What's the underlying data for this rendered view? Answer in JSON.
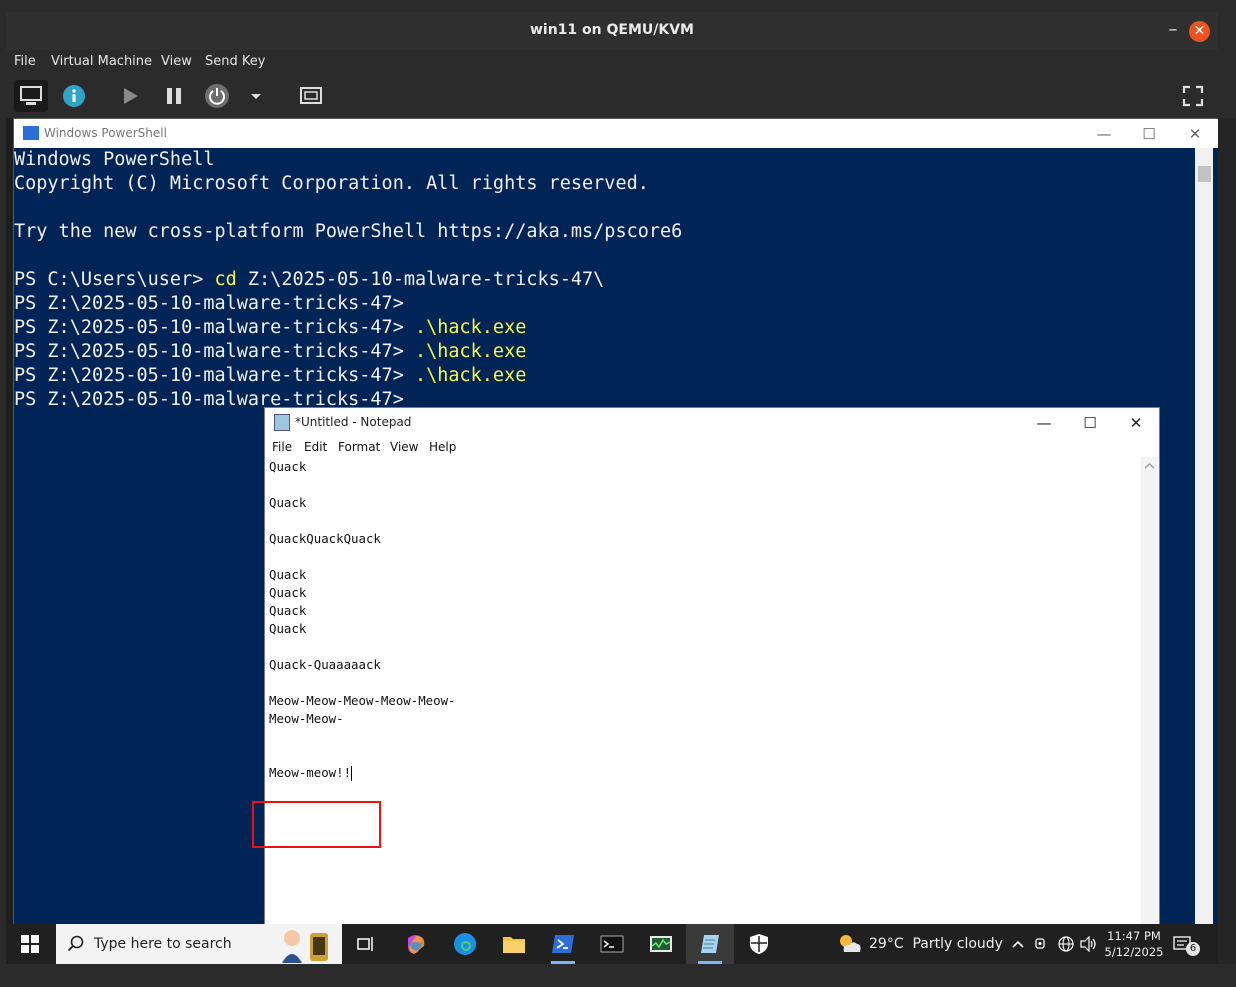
{
  "vm": {
    "title": "win11 on QEMU/KVM",
    "minimize": "–",
    "close": "✕",
    "menu": [
      "File",
      "Virtual Machine",
      "View",
      "Send Key"
    ]
  },
  "powershell": {
    "title": "Windows PowerShell",
    "controls": {
      "minimize": "—",
      "maximize": "☐",
      "close": "✕"
    },
    "lines": [
      {
        "text": "Windows PowerShell",
        "cmd": ""
      },
      {
        "text": "Copyright (C) Microsoft Corporation. All rights reserved.",
        "cmd": ""
      },
      {
        "text": "",
        "cmd": ""
      },
      {
        "text": "Try the new cross-platform PowerShell https://aka.ms/pscore6",
        "cmd": ""
      },
      {
        "text": "",
        "cmd": ""
      },
      {
        "text": "PS C:\\Users\\user> ",
        "cmd": "cd",
        "rest": " Z:\\2025-05-10-malware-tricks-47\\"
      },
      {
        "text": "PS Z:\\2025-05-10-malware-tricks-47>",
        "cmd": ""
      },
      {
        "text": "PS Z:\\2025-05-10-malware-tricks-47> ",
        "cmd": ".\\hack.exe"
      },
      {
        "text": "PS Z:\\2025-05-10-malware-tricks-47> ",
        "cmd": ".\\hack.exe"
      },
      {
        "text": "PS Z:\\2025-05-10-malware-tricks-47> ",
        "cmd": ".\\hack.exe"
      },
      {
        "text": "PS Z:\\2025-05-10-malware-tricks-47> ",
        "cmd": "_"
      }
    ]
  },
  "notepad": {
    "title": "*Untitled - Notepad",
    "controls": {
      "minimize": "—",
      "maximize": "☐",
      "close": "✕"
    },
    "menu": [
      "File",
      "Edit",
      "Format",
      "View",
      "Help"
    ],
    "lines": [
      "Quack",
      "",
      "Quack",
      "",
      "QuackQuackQuack",
      "",
      "Quack",
      "Quack",
      "Quack",
      "Quack",
      "",
      "Quack-Quaaaaack",
      "",
      "Meow-Meow-Meow-Meow-Meow-",
      "Meow-Meow-",
      "",
      "",
      "Meow-meow!!"
    ]
  },
  "taskbar": {
    "search_placeholder": "Type here to search",
    "weather": "29°C  Partly cloudy",
    "time": "11:47 PM",
    "date": "5/12/2025",
    "notification_count": "6"
  },
  "colors": {
    "accent": "#e95420",
    "ps_bg": "#012456",
    "highlight": "#ee1111"
  }
}
